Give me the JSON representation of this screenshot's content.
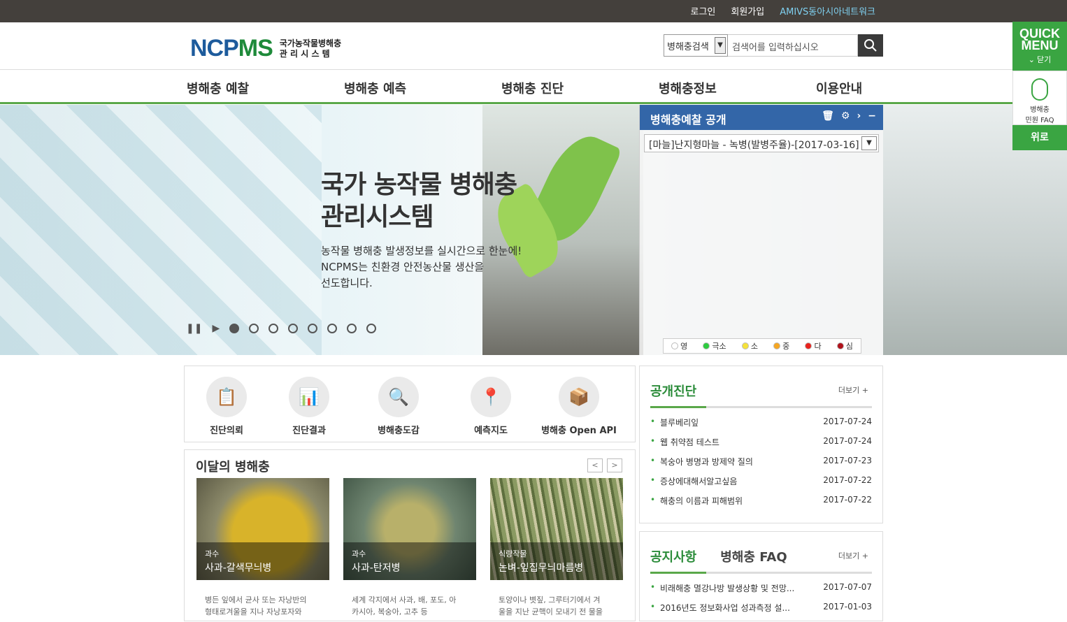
{
  "topbar": {
    "login": "로그인",
    "join": "회원가입",
    "network": "AMIVS동아시아네트워크"
  },
  "logo": {
    "brand_a": "NCP",
    "brand_b": "MS",
    "sub1": "국가농작물병해충",
    "sub2": "관 리 시 스 템"
  },
  "search": {
    "select_value": "병해충검색",
    "placeholder": "검색어를 입력하십시오"
  },
  "nav": [
    "병해충 예찰",
    "병해충 예측",
    "병해충 진단",
    "병해충정보",
    "이용안내"
  ],
  "hero": {
    "title1": "국가 농작물 병해충",
    "title2": "관리시스템",
    "desc1": "농작물 병해충 발생정보를 실시간으로 한눈에!",
    "desc2": "NCPMS는 친환경 안전농산물 생산을",
    "desc3": "선도합니다.",
    "slides": 8,
    "active_slide": 1
  },
  "panel": {
    "title": "병해충예찰 공개",
    "dropdown": "[마늘]난지형마늘 - 녹병(발병주율)-[2017-03-16]",
    "legend": [
      {
        "label": "영",
        "color": "#ffffff"
      },
      {
        "label": "극소",
        "color": "#2ecc40"
      },
      {
        "label": "소",
        "color": "#f5e23a"
      },
      {
        "label": "중",
        "color": "#f5a623"
      },
      {
        "label": "다",
        "color": "#e8231e"
      },
      {
        "label": "심",
        "color": "#b0121b"
      }
    ]
  },
  "quick": {
    "title1": "QUICK",
    "title2": "MENU",
    "close": "닫기",
    "faq1": "병해충",
    "faq2": "민원 FAQ",
    "up": "위로"
  },
  "services": [
    "진단의뢰",
    "진단결과",
    "병해충도감",
    "예측지도",
    "병해충 Open API"
  ],
  "monthly": {
    "title": "이달의 병해충",
    "cards": [
      {
        "category": "과수",
        "name": "사과-갈색무늬병",
        "desc1": "병든 잎에서 균사 또는 자낭반의",
        "desc2": "형태로겨울을 지나 자낭포자와"
      },
      {
        "category": "과수",
        "name": "사과-탄저병",
        "desc1": "세계 각지에서 사과, 배, 포도, 아",
        "desc2": "카시아, 복숭아, 고추 등"
      },
      {
        "category": "식량작물",
        "name": "논벼-잎집무늬마름병",
        "desc1": "토양이나 볏짚, 그루터기에서 겨",
        "desc2": "울을 지난 균핵이 모내기 전 물을"
      }
    ]
  },
  "board1": {
    "tab": "공개진단",
    "more": "더보기",
    "items": [
      {
        "title": "블루베리잎",
        "date": "2017-07-24"
      },
      {
        "title": "웹 취약점 테스트",
        "date": "2017-07-24"
      },
      {
        "title": "복숭아 병명과 방제약 질의",
        "date": "2017-07-23"
      },
      {
        "title": "증상에대해서알고싶음",
        "date": "2017-07-22"
      },
      {
        "title": "해충의 이름과 피해범위",
        "date": "2017-07-22"
      }
    ]
  },
  "board2": {
    "tab1": "공지사항",
    "tab2": "병해충 FAQ",
    "more": "더보기",
    "items": [
      {
        "title": "비래해충 멸강나방 발생상황 및 전망...",
        "date": "2017-07-07"
      },
      {
        "title": "2016년도 정보화사업 성과측정 설...",
        "date": "2017-01-03"
      }
    ]
  }
}
